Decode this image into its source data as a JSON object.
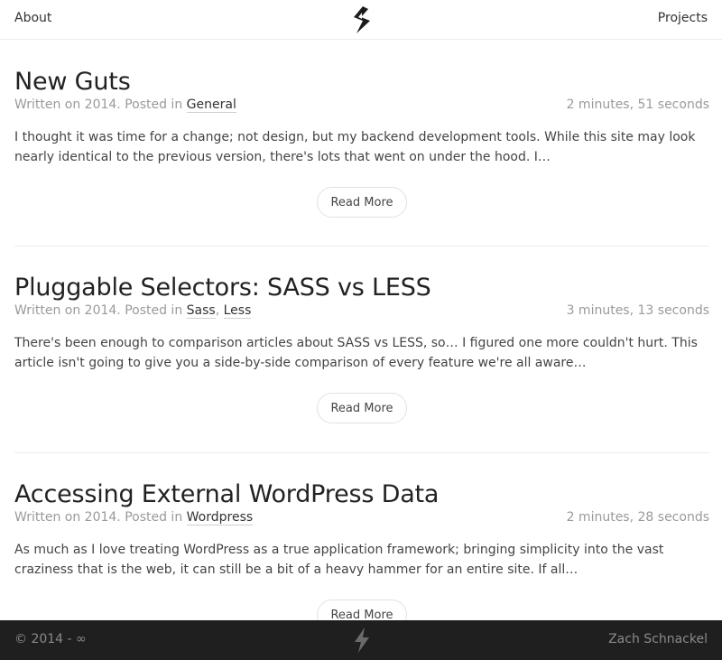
{
  "header": {
    "about_label": "About",
    "projects_label": "Projects",
    "logo_icon": "lightning-logo-icon"
  },
  "posts": [
    {
      "title": "New Guts",
      "meta_prefix": "Written on 2014. Posted in ",
      "categories": [
        "General"
      ],
      "reading_time": "2 minutes, 51 seconds",
      "excerpt": "I thought it was time for a change; not design, but my backend development tools. While this site may look nearly identical to the previous version, there's lots that went on under the hood. I…",
      "button_label": "Read More"
    },
    {
      "title": "Pluggable Selectors: SASS vs LESS",
      "meta_prefix": "Written on 2014. Posted in ",
      "categories": [
        "Sass",
        "Less"
      ],
      "category_separator": ", ",
      "reading_time": "3 minutes, 13 seconds",
      "excerpt": "There's been enough to comparison articles about SASS vs LESS, so… I figured one more couldn't hurt. This article isn't going to give you a side-by-side comparison of every feature we're all aware…",
      "button_label": "Read More"
    },
    {
      "title": "Accessing External WordPress Data",
      "meta_prefix": "Written on 2014. Posted in ",
      "categories": [
        "Wordpress"
      ],
      "reading_time": "2 minutes, 28 seconds",
      "excerpt": "As much as I love treating WordPress as a true application framework; bringing simplicity into the vast craziness that is the web, it can still be a bit of a heavy hammer for an entire site. If all…",
      "button_label": "Read More"
    }
  ],
  "footer": {
    "copyright": "© 2014 - ∞",
    "author": "Zach Schnackel",
    "logo_icon": "lightning-footer-icon"
  },
  "colors": {
    "footer_bg": "#1f1f1f",
    "text": "#333333",
    "muted": "#9a9a9a"
  }
}
